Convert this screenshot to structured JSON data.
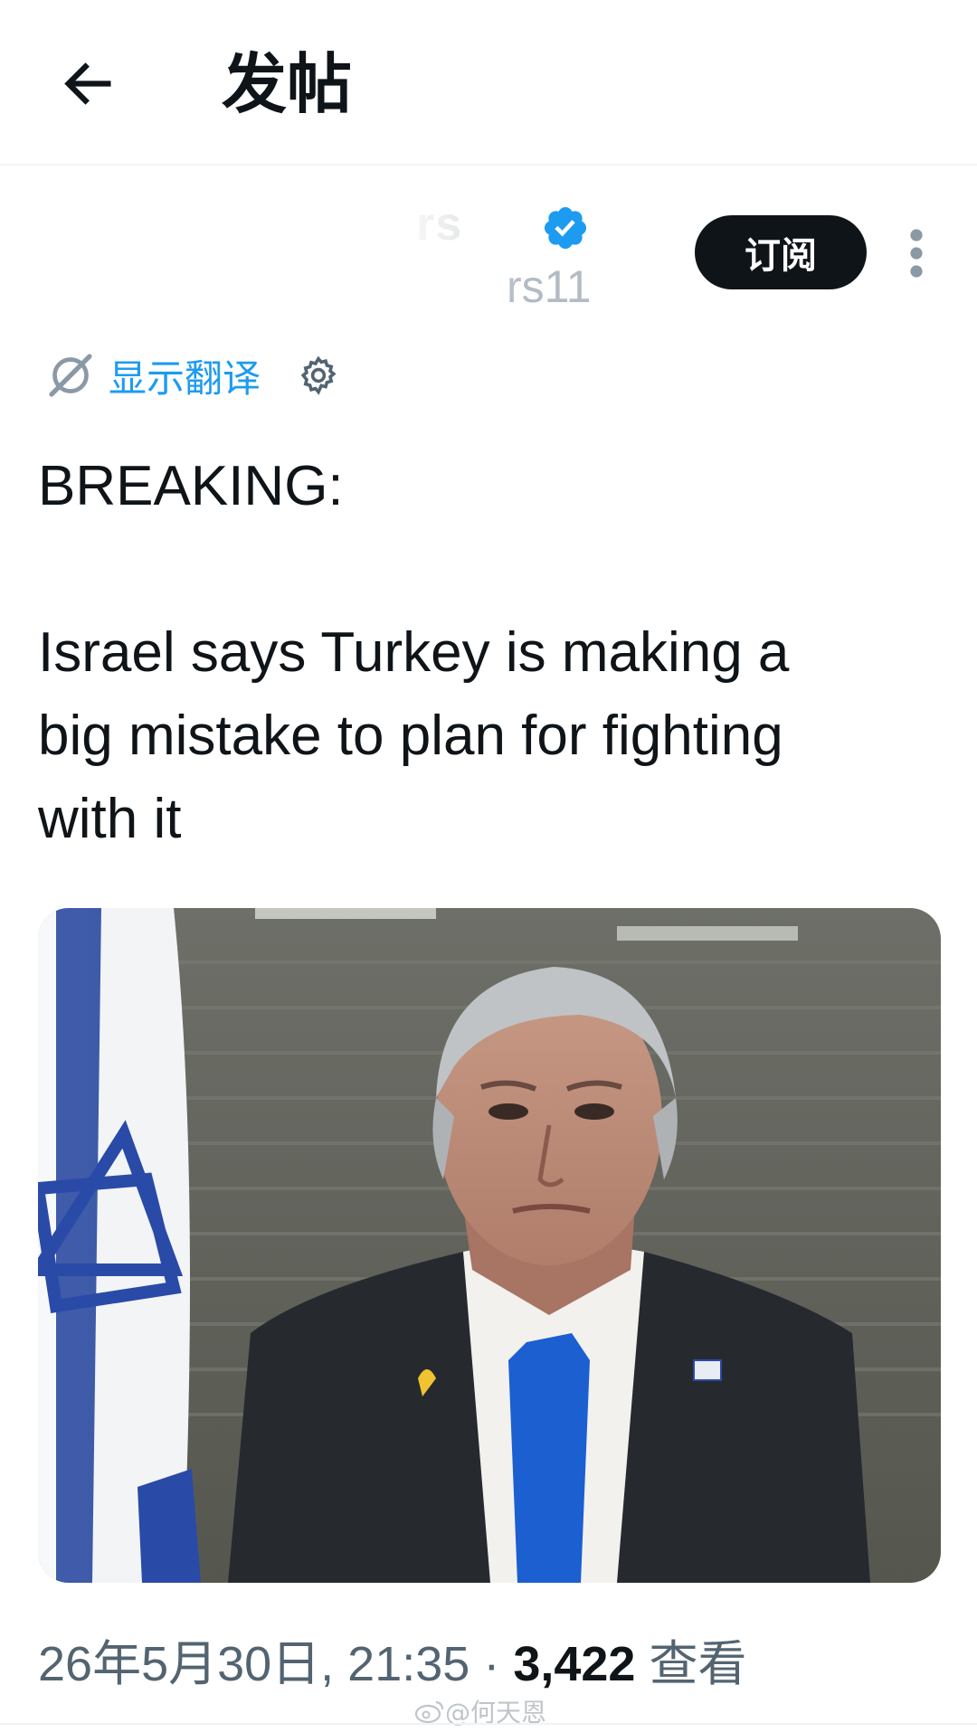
{
  "header": {
    "back_icon": "arrow-left-icon",
    "title": "发帖"
  },
  "author": {
    "display_name": "rs",
    "handle": "rs11",
    "verified_icon": "verified-badge-icon",
    "subscribe_label": "订阅",
    "more_icon": "more-vertical-icon"
  },
  "translate": {
    "icon": "translate-icon",
    "label": "显示翻译",
    "settings_icon": "gear-icon"
  },
  "post": {
    "text": "BREAKING:\n\nIsrael says Turkey is making a\nbig mistake to plan for fighting\nwith it"
  },
  "meta": {
    "datetime": "26年5月30日, 21:35",
    "separator": " · ",
    "views_count": "3,422",
    "views_label": " 查看"
  },
  "watermark": {
    "text": "@何天恩"
  },
  "colors": {
    "accent": "#1d9bf0",
    "text_primary": "#0f1419",
    "text_secondary": "#536471"
  }
}
